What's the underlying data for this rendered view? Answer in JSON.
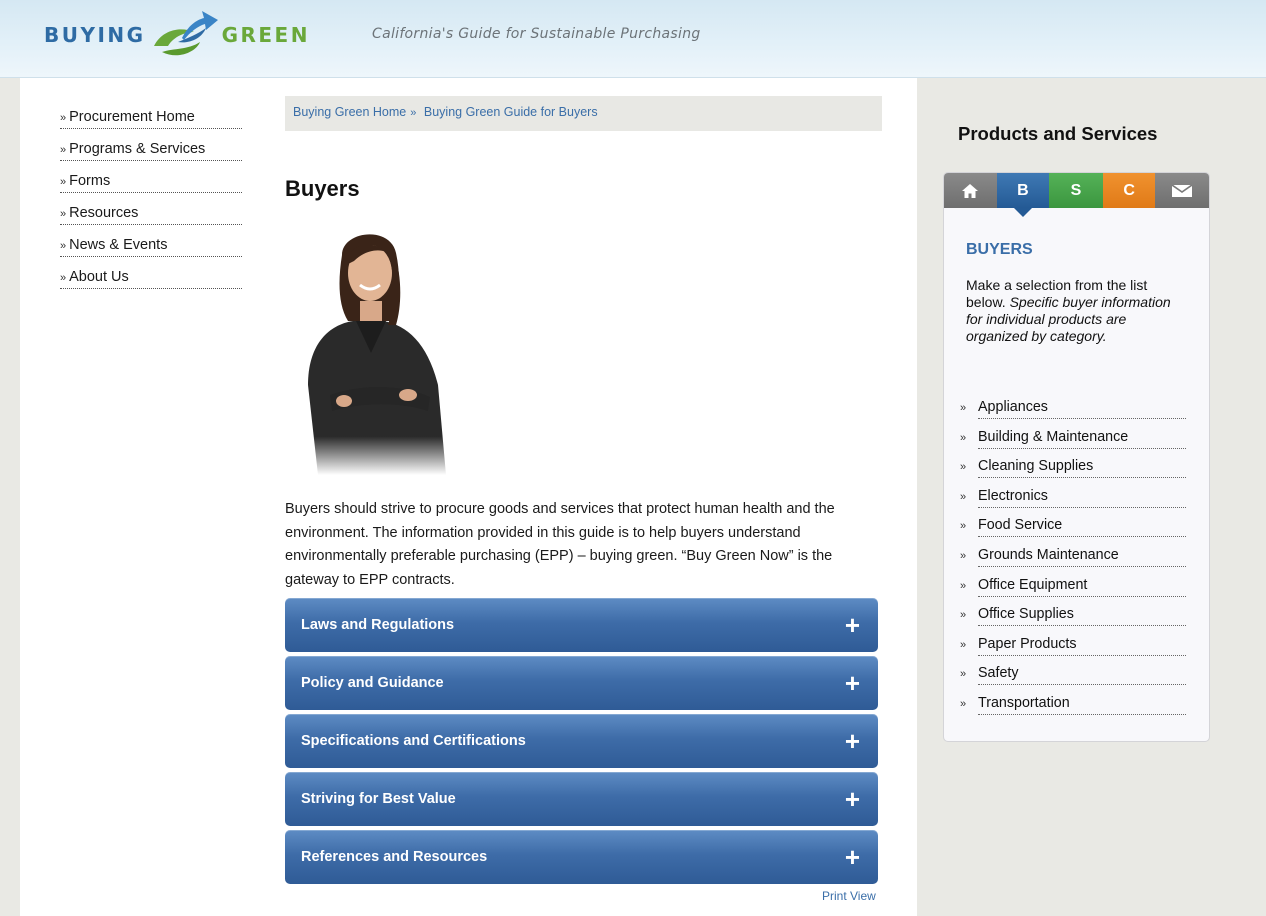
{
  "header": {
    "logo_left": "BUYING",
    "logo_right": "GREEN",
    "tagline": "California's Guide for Sustainable Purchasing"
  },
  "left_nav": {
    "marker": "»",
    "items": [
      {
        "label": "Procurement Home"
      },
      {
        "label": "Programs & Services"
      },
      {
        "label": "Forms"
      },
      {
        "label": "Resources"
      },
      {
        "label": "News & Events"
      },
      {
        "label": "About Us"
      }
    ]
  },
  "breadcrumb": {
    "items": [
      "Buying Green Home",
      "Buying Green Guide for Buyers"
    ],
    "separator": "»"
  },
  "main": {
    "title": "Buyers",
    "intro": "Buyers should strive to procure goods and services that protect human health and the environment. The information provided in this guide is to help buyers understand environmentally preferable purchasing (EPP) – buying green. “Buy Green Now” is the gateway to EPP contracts.",
    "accordion": [
      {
        "label": "Laws and Regulations",
        "icon": "plus-icon",
        "symbol": "+"
      },
      {
        "label": "Policy and Guidance",
        "icon": "plus-icon",
        "symbol": "+"
      },
      {
        "label": "Specifications and Certifications",
        "icon": "plus-icon",
        "symbol": "+"
      },
      {
        "label": "Striving for Best Value",
        "icon": "plus-icon",
        "symbol": "+"
      },
      {
        "label": "References and Resources",
        "icon": "plus-icon",
        "symbol": "+"
      }
    ],
    "print_view": "Print View"
  },
  "sidebar": {
    "title": "Products and Services",
    "tabs": [
      {
        "label": "",
        "icon": "home-icon",
        "color": "#7c7c7c"
      },
      {
        "label": "B",
        "color": "#2f67a3",
        "active": true
      },
      {
        "label": "S",
        "color": "#49a64c"
      },
      {
        "label": "C",
        "color": "#e9861f"
      },
      {
        "label": "",
        "icon": "mail-icon",
        "color": "#7c7c7c"
      }
    ],
    "heading": "BUYERS",
    "desc_plain": "Make a selection from the list below.",
    "desc_italic": "Specific buyer information for individual products are organized by category.",
    "marker": "»",
    "categories": [
      "Appliances",
      "Building & Maintenance",
      "Cleaning Supplies",
      "Electronics",
      "Food Service",
      "Grounds Maintenance",
      "Office Equipment",
      "Office Supplies",
      "Paper Products",
      "Safety",
      "Transportation"
    ]
  },
  "colors": {
    "brand_blue": "#2e6ba4",
    "brand_green": "#6aa83a",
    "link_blue": "#3a6ea8",
    "accordion_blue": "#3e6ca8"
  }
}
